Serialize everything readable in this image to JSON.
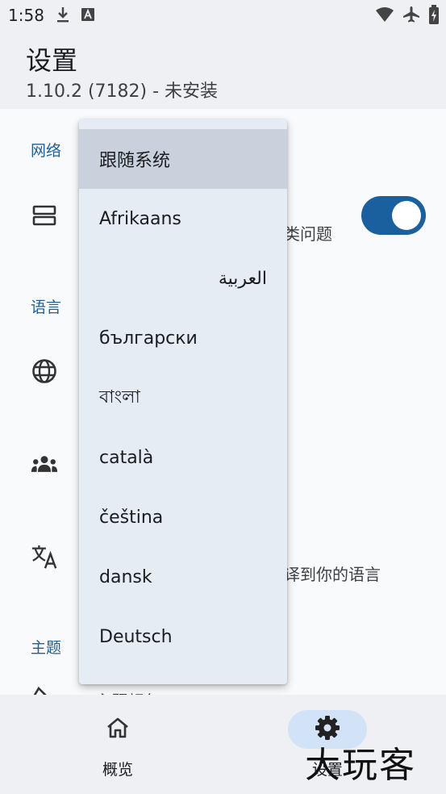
{
  "status_bar": {
    "time": "1:58",
    "icons_left": [
      "download-icon",
      "text-a-icon"
    ],
    "icons_right": [
      "wifi-icon",
      "airplane-icon",
      "battery-charging-icon"
    ]
  },
  "header": {
    "title": "设置",
    "subtitle": "1.10.2 (7182) - 未安装"
  },
  "sections": {
    "network": {
      "header": "网络",
      "row_text_partial": "类问题",
      "icon": "server-icon",
      "switch_on": true
    },
    "language": {
      "header": "语言",
      "row1_icon": "globe-icon",
      "row2_icon": "group-icon",
      "row3_icon": "translate-icon",
      "row3_text_partial": "译到你的语言"
    },
    "theme": {
      "header": "主题",
      "row_text_partial": "主题颜色"
    }
  },
  "dropdown": {
    "items": [
      {
        "label": "跟随系统",
        "selected": true
      },
      {
        "label": "Afrikaans",
        "selected": false
      },
      {
        "label": "العربية",
        "selected": false,
        "rtl": true
      },
      {
        "label": "български",
        "selected": false
      },
      {
        "label": "বাংলা",
        "selected": false
      },
      {
        "label": "català",
        "selected": false
      },
      {
        "label": "čeština",
        "selected": false
      },
      {
        "label": "dansk",
        "selected": false
      },
      {
        "label": "Deutsch",
        "selected": false
      }
    ]
  },
  "bottom_nav": {
    "items": [
      {
        "label": "概览",
        "icon": "home-icon",
        "active": false
      },
      {
        "label": "设置",
        "icon": "gear-icon",
        "active": true
      }
    ]
  },
  "watermark": "大玩客",
  "colors": {
    "accent": "#1a5f9e",
    "section_header": "#1f5f9c",
    "menu_bg": "#e6ecf4",
    "menu_selected": "#c9d2dc",
    "nav_active_bg": "#d3e3f7"
  }
}
